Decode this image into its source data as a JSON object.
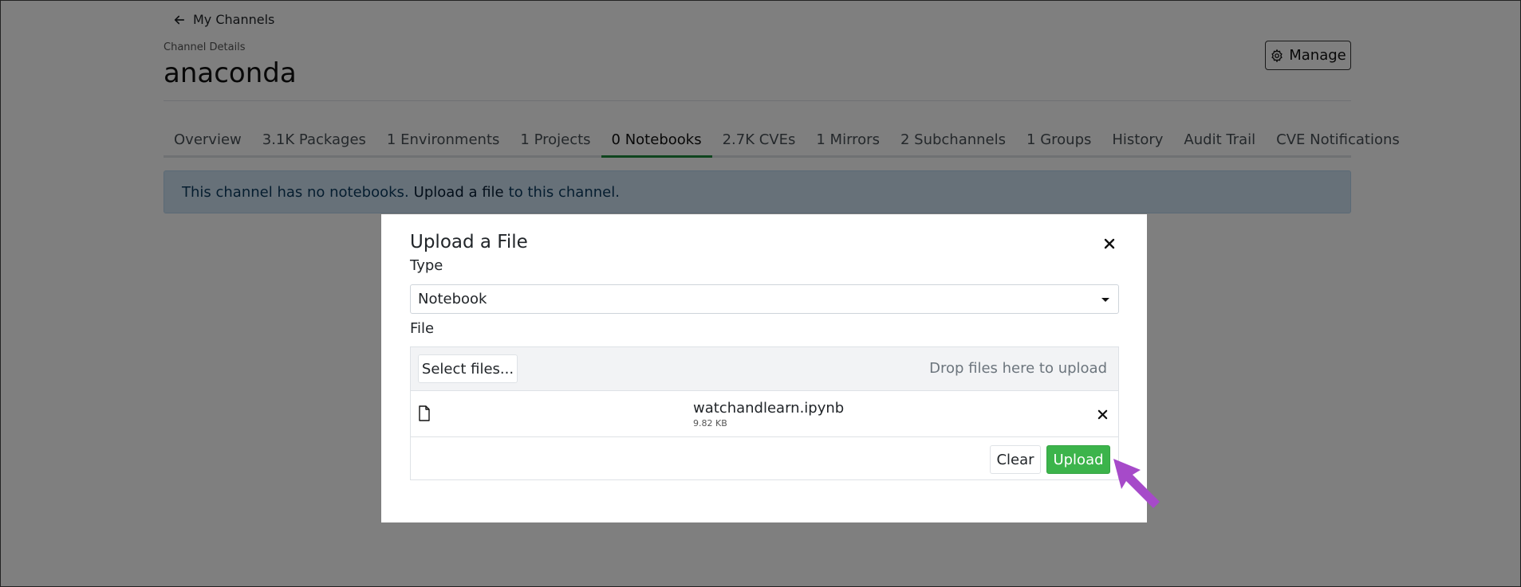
{
  "header": {
    "back_label": "My Channels",
    "subtitle": "Channel Details",
    "title": "anaconda",
    "manage_label": "Manage"
  },
  "tabs": [
    {
      "label": "Overview"
    },
    {
      "label": "3.1K Packages"
    },
    {
      "label": "1 Environments"
    },
    {
      "label": "1 Projects"
    },
    {
      "label": "0 Notebooks",
      "active": true
    },
    {
      "label": "2.7K CVEs"
    },
    {
      "label": "1 Mirrors"
    },
    {
      "label": "2 Subchannels"
    },
    {
      "label": "1 Groups"
    },
    {
      "label": "History"
    },
    {
      "label": "Audit Trail"
    },
    {
      "label": "CVE Notifications"
    }
  ],
  "alert": {
    "text_before": "This channel has no notebooks.",
    "link": "Upload a file",
    "text_after": "to this channel."
  },
  "modal": {
    "title": "Upload a File",
    "type_label": "Type",
    "type_value": "Notebook",
    "file_label": "File",
    "select_files_label": "Select files...",
    "drop_hint": "Drop files here to upload",
    "file": {
      "name": "watchandlearn.ipynb",
      "size": "9.82 KB"
    },
    "clear_label": "Clear",
    "upload_label": "Upload"
  },
  "colors": {
    "accent_green": "#3cb44b",
    "tab_active_underline": "#1e8a3d",
    "pointer_arrow": "#a64ac9",
    "alert_bg": "#cfe2f3"
  }
}
